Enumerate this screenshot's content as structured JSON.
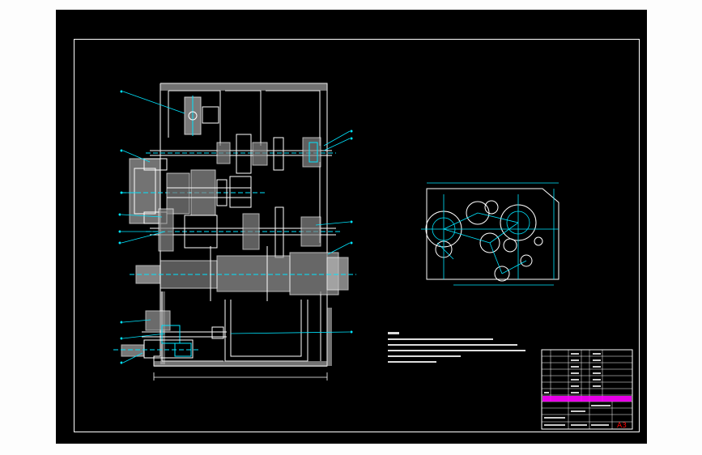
{
  "drawing": {
    "sheet_size": "A3",
    "background": "#000000",
    "colors": {
      "outline": "#ffffff",
      "annotation": "#00e5ff",
      "title_accent": "#ff00ff",
      "sheet_size_text": "#ff0000"
    }
  }
}
